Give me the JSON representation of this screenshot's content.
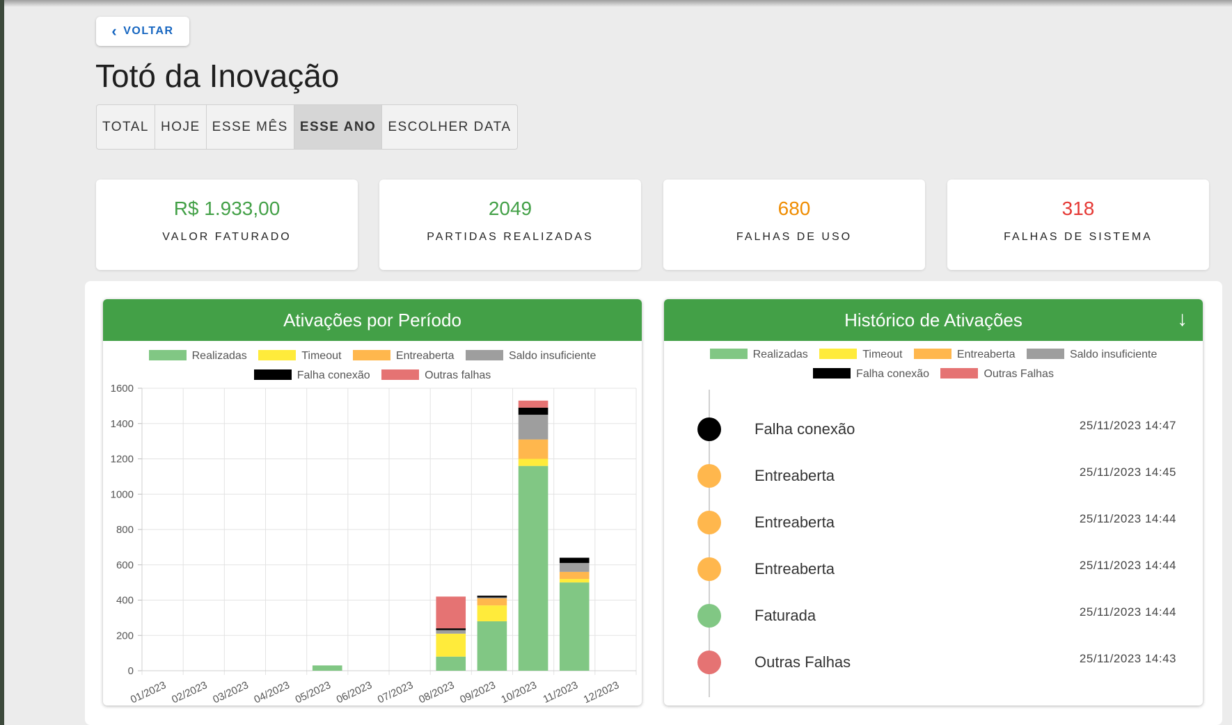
{
  "back_button": {
    "label": "VOLTAR",
    "icon": "chevron-left-icon"
  },
  "title": "Totó da Inovação",
  "period_tabs": [
    {
      "label": "TOTAL",
      "active": false
    },
    {
      "label": "HOJE",
      "active": false
    },
    {
      "label": "ESSE MÊS",
      "active": false
    },
    {
      "label": "ESSE ANO",
      "active": true
    },
    {
      "label": "ESCOLHER DATA",
      "active": false
    }
  ],
  "stats": [
    {
      "value": "R$ 1.933,00",
      "label": "VALOR FATURADO",
      "color": "#43a047"
    },
    {
      "value": "2049",
      "label": "PARTIDAS REALIZADAS",
      "color": "#43a047"
    },
    {
      "value": "680",
      "label": "FALHAS DE USO",
      "color": "#ef8c00"
    },
    {
      "value": "318",
      "label": "FALHAS DE SISTEMA",
      "color": "#e53935"
    }
  ],
  "activations_chart": {
    "header": "Ativações por Período",
    "legend": [
      {
        "label": "Realizadas",
        "color": "#81c784"
      },
      {
        "label": "Timeout",
        "color": "#ffeb3b"
      },
      {
        "label": "Entreaberta",
        "color": "#ffb74d"
      },
      {
        "label": "Saldo insuficiente",
        "color": "#9e9e9e"
      },
      {
        "label": "Falha conexão",
        "color": "#000000"
      },
      {
        "label": "Outras falhas",
        "color": "#e57373"
      }
    ]
  },
  "chart_data": {
    "type": "bar",
    "stacked": true,
    "title": "Ativações por Período",
    "categories": [
      "01/2023",
      "02/2023",
      "03/2023",
      "04/2023",
      "05/2023",
      "06/2023",
      "07/2023",
      "08/2023",
      "09/2023",
      "10/2023",
      "11/2023",
      "12/2023"
    ],
    "ylim": [
      0,
      1600
    ],
    "yticks": [
      "0",
      "200",
      "400",
      "600",
      "800",
      "1000",
      "1200",
      "1400",
      "1600"
    ],
    "grid": true,
    "series": [
      {
        "name": "Realizadas",
        "color": "#81c784",
        "values": [
          0,
          0,
          0,
          0,
          30,
          0,
          0,
          80,
          280,
          1160,
          500,
          0
        ]
      },
      {
        "name": "Timeout",
        "color": "#ffeb3b",
        "values": [
          0,
          0,
          0,
          0,
          0,
          0,
          0,
          130,
          90,
          40,
          20,
          0
        ]
      },
      {
        "name": "Entreaberta",
        "color": "#ffb74d",
        "values": [
          0,
          0,
          0,
          0,
          0,
          0,
          0,
          0,
          40,
          110,
          40,
          0
        ]
      },
      {
        "name": "Saldo insuficiente",
        "color": "#9e9e9e",
        "values": [
          0,
          0,
          0,
          0,
          0,
          0,
          0,
          20,
          5,
          140,
          50,
          0
        ]
      },
      {
        "name": "Falha conexão",
        "color": "#000000",
        "values": [
          0,
          0,
          0,
          0,
          0,
          0,
          0,
          10,
          10,
          40,
          30,
          0
        ]
      },
      {
        "name": "Outras falhas",
        "color": "#e57373",
        "values": [
          0,
          0,
          0,
          0,
          0,
          0,
          0,
          180,
          0,
          40,
          0,
          0
        ]
      }
    ]
  },
  "history": {
    "header": "Histórico de Ativações",
    "arrow_icon": "arrow-down-icon",
    "legend": [
      {
        "label": "Realizadas",
        "color": "#81c784"
      },
      {
        "label": "Timeout",
        "color": "#ffeb3b"
      },
      {
        "label": "Entreaberta",
        "color": "#ffb74d"
      },
      {
        "label": "Saldo insuficiente",
        "color": "#9e9e9e"
      },
      {
        "label": "Falha conexão",
        "color": "#000000"
      },
      {
        "label": "Outras Falhas",
        "color": "#e57373"
      }
    ],
    "items": [
      {
        "label": "Falha conexão",
        "time": "25/11/2023 14:47",
        "color": "#000000"
      },
      {
        "label": "Entreaberta",
        "time": "25/11/2023 14:45",
        "color": "#ffb74d"
      },
      {
        "label": "Entreaberta",
        "time": "25/11/2023 14:44",
        "color": "#ffb74d"
      },
      {
        "label": "Entreaberta",
        "time": "25/11/2023 14:44",
        "color": "#ffb74d"
      },
      {
        "label": "Faturada",
        "time": "25/11/2023 14:44",
        "color": "#81c784"
      },
      {
        "label": "Outras Falhas",
        "time": "25/11/2023 14:43",
        "color": "#e57373"
      }
    ]
  }
}
